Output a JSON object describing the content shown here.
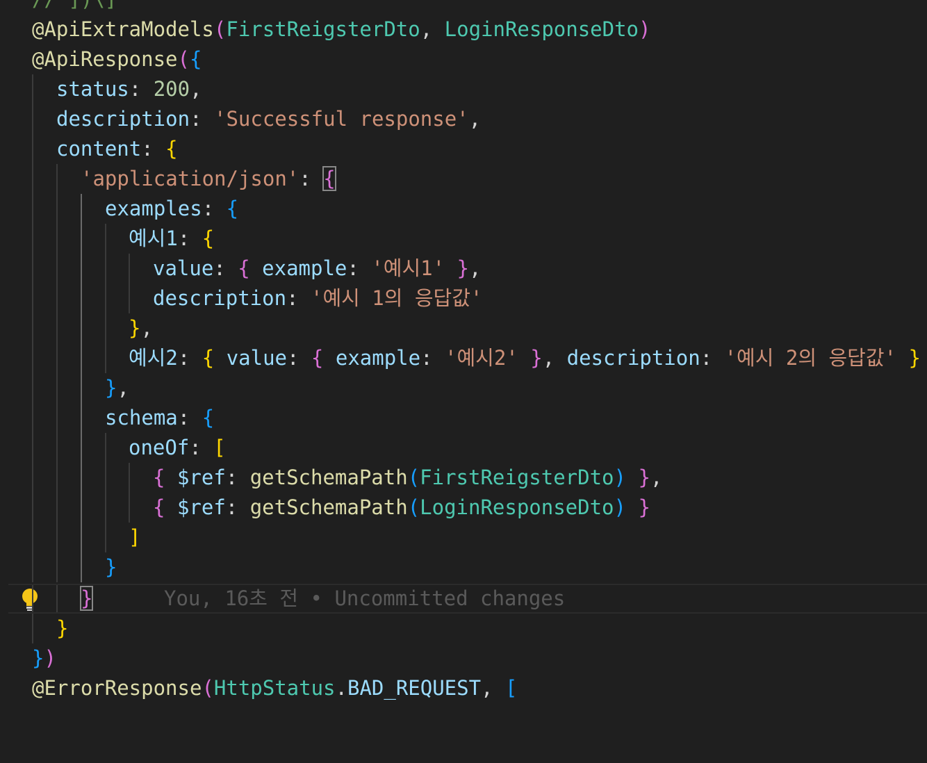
{
  "editor": {
    "blame": {
      "author": "You,",
      "time": "16초 전",
      "sep": "•",
      "message": "Uncommitted changes"
    },
    "tokens": {
      "top_comment": "// ])\\]",
      "api_extra_models": "@ApiExtraModels",
      "first_dto": "FirstReigsterDto",
      "login_dto": "LoginResponseDto",
      "api_response": "@ApiResponse",
      "status_key": "status",
      "status_value": "200",
      "description_key": "description",
      "description_value": "'Successful response'",
      "content_key": "content",
      "app_json": "'application/json'",
      "examples_key": "examples",
      "ex1_key": "예시1",
      "value_key": "value",
      "example_key": "example",
      "ex1_value": "'예시1'",
      "ex1_desc": "'예시 1의 응답값'",
      "ex2_key": "예시2",
      "ex2_value": "'예시2'",
      "ex2_desc": "'예시 2의 응답값'",
      "schema_key": "schema",
      "oneof_key": "oneOf",
      "ref_key": "$ref",
      "get_schema_path": "getSchemaPath",
      "error_response": "@ErrorResponse",
      "http_status": "HttpStatus",
      "bad_request": "BAD_REQUEST"
    }
  },
  "colors": {
    "background": "#1f1f1f",
    "decorator": "#dcdcaa",
    "class": "#4ec9b0",
    "property": "#9cdcfe",
    "string": "#ce9178",
    "number": "#b5cea8",
    "bracket_gold": "#ffd700",
    "bracket_purple": "#da70d6",
    "bracket_blue": "#179fff"
  }
}
